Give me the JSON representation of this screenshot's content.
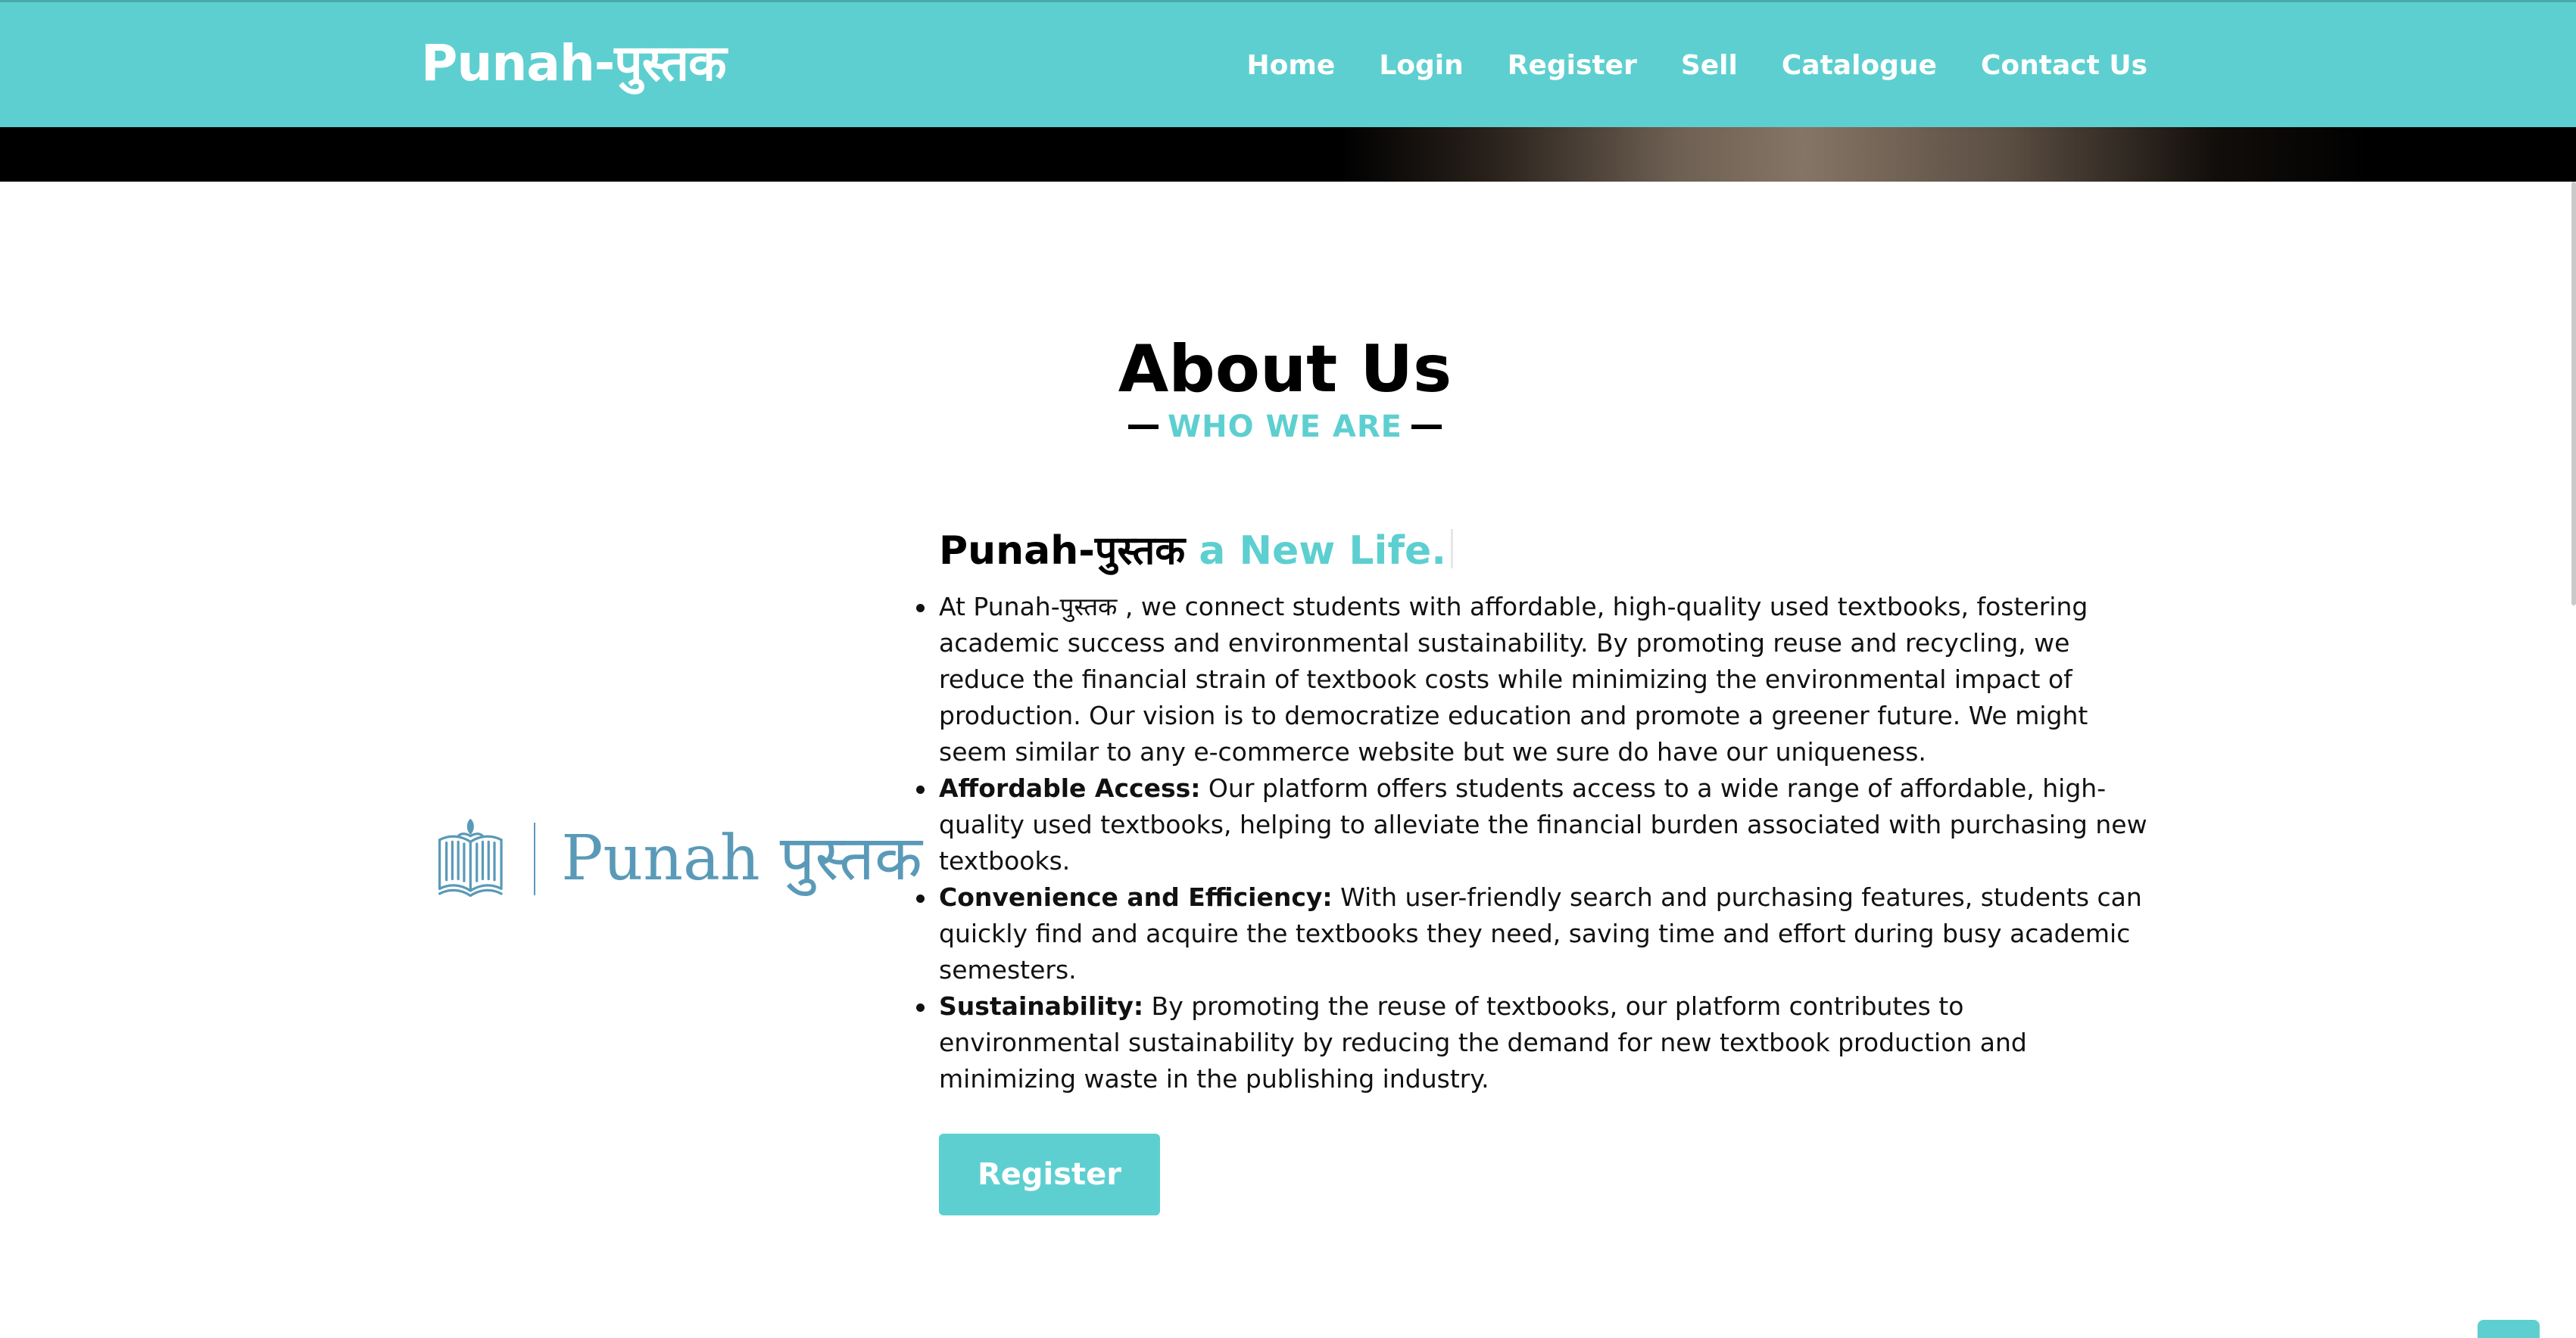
{
  "brand": "Punah-पुस्तक",
  "nav": {
    "home": "Home",
    "login": "Login",
    "register": "Register",
    "sell": "Sell",
    "catalogue": "Catalogue",
    "contact": "Contact Us"
  },
  "about": {
    "title": "About Us",
    "subtitle": "WHO WE ARE",
    "headline_main": "Punah-पुस्तक",
    "headline_accent": "a New Life.",
    "points": [
      {
        "label": "",
        "text": "At Punah-पुस्तक , we connect students with affordable, high-quality used textbooks, fostering academic success and environmental sustainability. By promoting reuse and recycling, we reduce the financial strain of textbook costs while minimizing the environmental impact of production. Our vision is to democratize education and promote a greener future. We might seem similar to any e-commerce website but we sure do have our uniqueness."
      },
      {
        "label": "Affordable Access:",
        "text": " Our platform offers students access to a wide range of affordable, high-quality used textbooks, helping to alleviate the financial burden associated with purchasing new textbooks."
      },
      {
        "label": "Convenience and Efficiency:",
        "text": " With user-friendly search and purchasing features, students can quickly find and acquire the textbooks they need, saving time and effort during busy academic semesters."
      },
      {
        "label": "Sustainability:",
        "text": " By promoting the reuse of textbooks, our platform contributes to environmental sustainability by reducing the demand for new textbook production and minimizing waste in the publishing industry."
      }
    ],
    "register_button": "Register"
  },
  "logo": {
    "icon": "open-book-icon",
    "text": "Punah पुस्तक"
  },
  "colors": {
    "accent": "#5ecfd0",
    "logo": "#5a9ab8",
    "text": "#111111"
  }
}
